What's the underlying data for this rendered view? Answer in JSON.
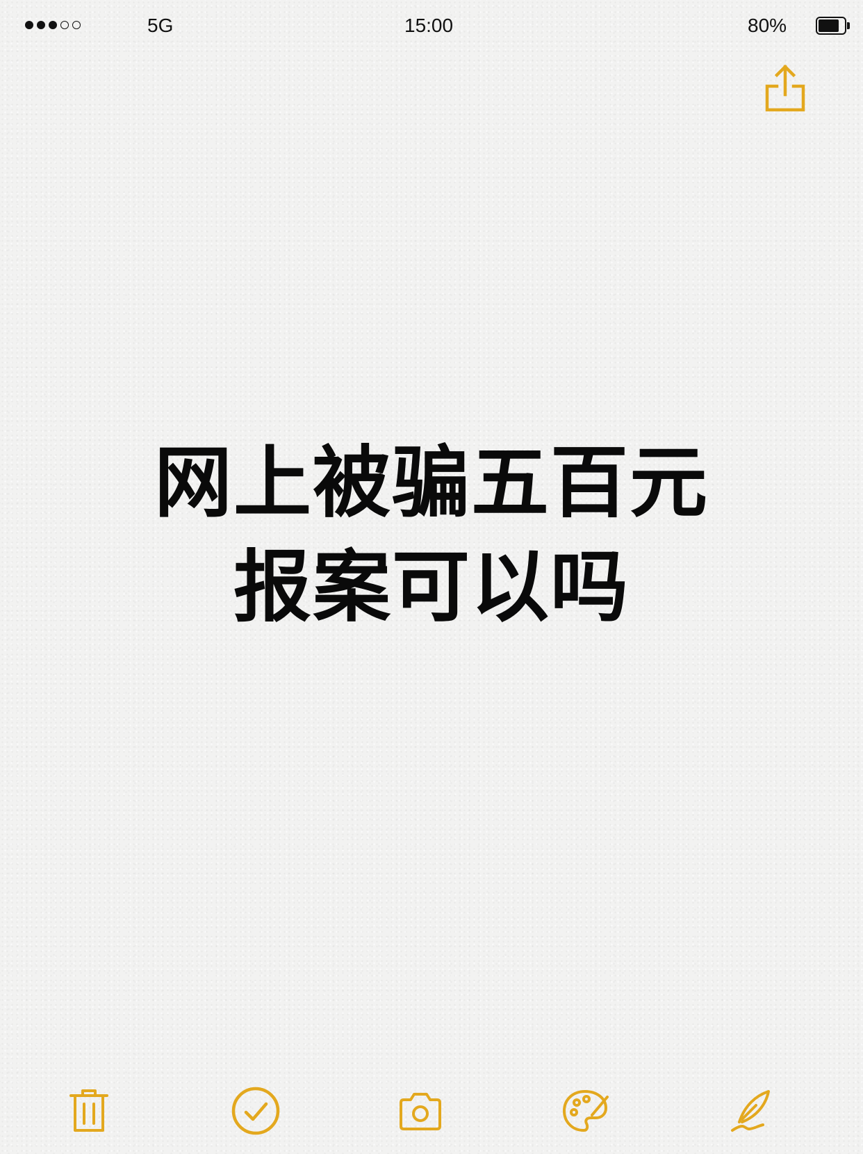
{
  "status_bar": {
    "signal_bars_total": 5,
    "signal_bars_filled": 3,
    "network": "5G",
    "time": "15:00",
    "battery_text": "80%",
    "battery_level": 0.8
  },
  "note": {
    "lines": [
      "网上被骗五百元",
      "报案可以吗"
    ]
  },
  "toolbar": {
    "items": [
      "trash-icon",
      "checklist-icon",
      "camera-icon",
      "palette-icon",
      "pen-icon"
    ]
  },
  "colors": {
    "accent": "#E3A81E",
    "text": "#0A0A0A",
    "background": "#F2F2F1"
  }
}
